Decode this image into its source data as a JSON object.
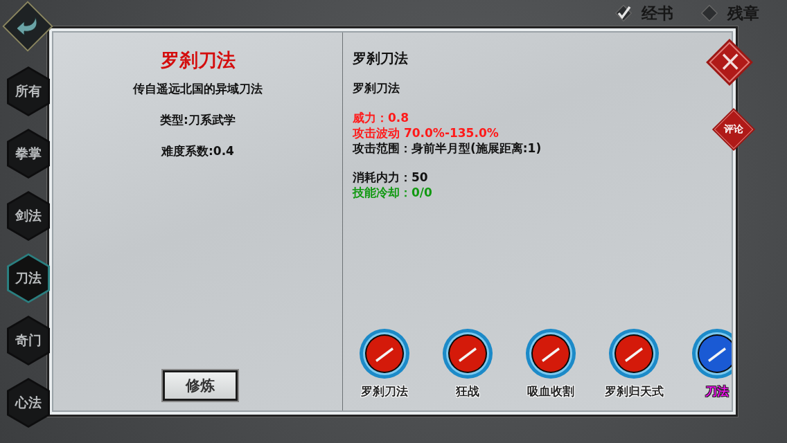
{
  "top_tabs": [
    {
      "label": "经书",
      "checked": true
    },
    {
      "label": "残章",
      "checked": false
    }
  ],
  "sidebar": {
    "tabs": [
      {
        "label": "所有",
        "selected": false
      },
      {
        "label": "拳掌",
        "selected": false
      },
      {
        "label": "剑法",
        "selected": false
      },
      {
        "label": "刀法",
        "selected": true
      },
      {
        "label": "奇门",
        "selected": false
      },
      {
        "label": "心法",
        "selected": false
      }
    ]
  },
  "book": {
    "title": "罗刹刀法",
    "description": "传自遥远北国的异域刀法",
    "type": "类型:刀系武学",
    "difficulty": "难度系数:0.4",
    "train_button": "修炼"
  },
  "skill_detail": {
    "title": "罗刹刀法",
    "name": "罗刹刀法",
    "groups": [
      [
        {
          "text": "威力：0.8",
          "color": "#ff1a1a"
        },
        {
          "text": "攻击波动 70.0%-135.0%",
          "color": "#ff1a1a"
        },
        {
          "text": "攻击范围：身前半月型(施展距离:1)",
          "color": "#111111"
        }
      ],
      [
        {
          "text": "消耗内力：50",
          "color": "#111111"
        },
        {
          "text": "技能冷却：0/0",
          "color": "#119911"
        }
      ]
    ]
  },
  "skills": [
    {
      "label": "罗刹刀法",
      "highlighted": false,
      "color": "#d41a0a"
    },
    {
      "label": "狂战",
      "highlighted": false,
      "color": "#d41a0a"
    },
    {
      "label": "吸血收割",
      "highlighted": false,
      "color": "#d41a0a"
    },
    {
      "label": "罗刹归天式",
      "highlighted": false,
      "color": "#d41a0a"
    },
    {
      "label": "刀法",
      "highlighted": true,
      "color": "#1a5ad4"
    }
  ],
  "close_button": {
    "label": "×"
  },
  "comment_button": {
    "label": "评论"
  }
}
